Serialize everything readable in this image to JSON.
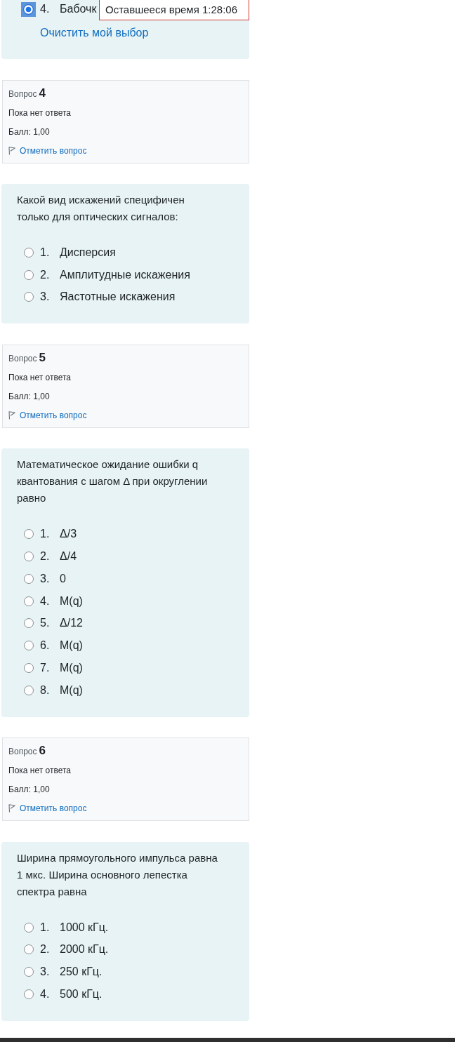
{
  "timer": {
    "text": "Оставшееся время 1:28:06"
  },
  "previous_answer": {
    "options": [
      {
        "number": "4.",
        "text": "Бабочк",
        "selected": true
      }
    ],
    "clear_link": "Очистить мой выбор"
  },
  "questions": [
    {
      "info": {
        "label": "Вопрос",
        "number": "4",
        "status": "Пока нет ответа",
        "score": "Балл: 1,00",
        "flag_link": "Отметить вопрос"
      },
      "text": "Какой вид искажений специфичен только для оптических сигналов:",
      "options": [
        {
          "number": "1.",
          "text": "Дисперсия",
          "selected": false
        },
        {
          "number": "2.",
          "text": "Амплитудные искажения",
          "selected": false
        },
        {
          "number": "3.",
          "text": "Яастотные искажения",
          "selected": false
        }
      ]
    },
    {
      "info": {
        "label": "Вопрос",
        "number": "5",
        "status": "Пока нет ответа",
        "score": "Балл: 1,00",
        "flag_link": "Отметить вопрос"
      },
      "text": "Математическое ожидание ошибки q квантования с шагом Δ при округлении равно",
      "options": [
        {
          "number": "1.",
          "text": "Δ/3",
          "selected": false
        },
        {
          "number": "2.",
          "text": "Δ/4",
          "selected": false
        },
        {
          "number": "3.",
          "text": "0",
          "selected": false
        },
        {
          "number": "4.",
          "text": "M(q)",
          "selected": false
        },
        {
          "number": "5.",
          "text": "Δ/12",
          "selected": false
        },
        {
          "number": "6.",
          "text": "M(q)",
          "selected": false
        },
        {
          "number": "7.",
          "text": "M(q)",
          "selected": false
        },
        {
          "number": "8.",
          "text": "M(q)",
          "selected": false
        }
      ]
    },
    {
      "info": {
        "label": "Вопрос",
        "number": "6",
        "status": "Пока нет ответа",
        "score": "Балл: 1,00",
        "flag_link": "Отметить вопрос"
      },
      "text": "Ширина прямоугольного импульса равна 1 мкс. Ширина основного лепестка спектра равна",
      "options": [
        {
          "number": "1.",
          "text": "1000 кГц.",
          "selected": false
        },
        {
          "number": "2.",
          "text": "2000 кГц.",
          "selected": false
        },
        {
          "number": "3.",
          "text": "250 кГц.",
          "selected": false
        },
        {
          "number": "4.",
          "text": "500 кГц.",
          "selected": false
        }
      ]
    }
  ]
}
